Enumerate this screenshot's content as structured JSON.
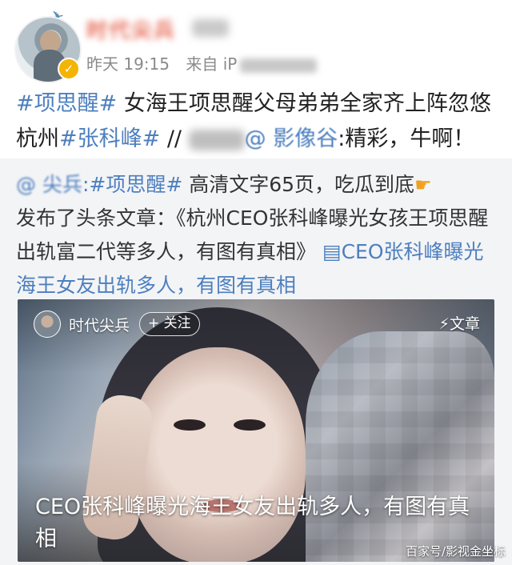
{
  "post": {
    "author_blurred": "时代尖兵",
    "meta_time": "昨天 19:15",
    "meta_source_prefix": "来自 iP",
    "text_tag1": "#项思醒#",
    "text_body1": " 女海王项思醒父母弟弟全家齐上阵忽悠杭州",
    "text_tag2": "#张科峰#",
    "text_sep": " //",
    "text_user2_partial": "@ 影像谷",
    "text_body2": ":精彩，牛啊！"
  },
  "repost": {
    "author_partial": "@ 尖兵",
    "sep": ":",
    "tag": "#项思醒#",
    "line1_rest": " 高清文字65页，吃瓜到底",
    "pointing_icon": "pointing-hand",
    "body": "发布了头条文章：《杭州CEO张科峰曝光女孩王项思醒出轨富二代等多人，有图有真相》",
    "link_icon": "article-link",
    "link_text": "CEO张科峰曝光海王女友出轨多人，有图有真相"
  },
  "card": {
    "author": "时代尖兵",
    "follow_label": "+ 关注",
    "article_label": "文章",
    "title": "CEO张科峰曝光海王女友出轨多人，有图有真相"
  },
  "watermark": "百家号/影视金坐标",
  "colors": {
    "tag": "#4d7fbf",
    "background": "#ffffff",
    "repost_bg": "#f3f4f6"
  }
}
